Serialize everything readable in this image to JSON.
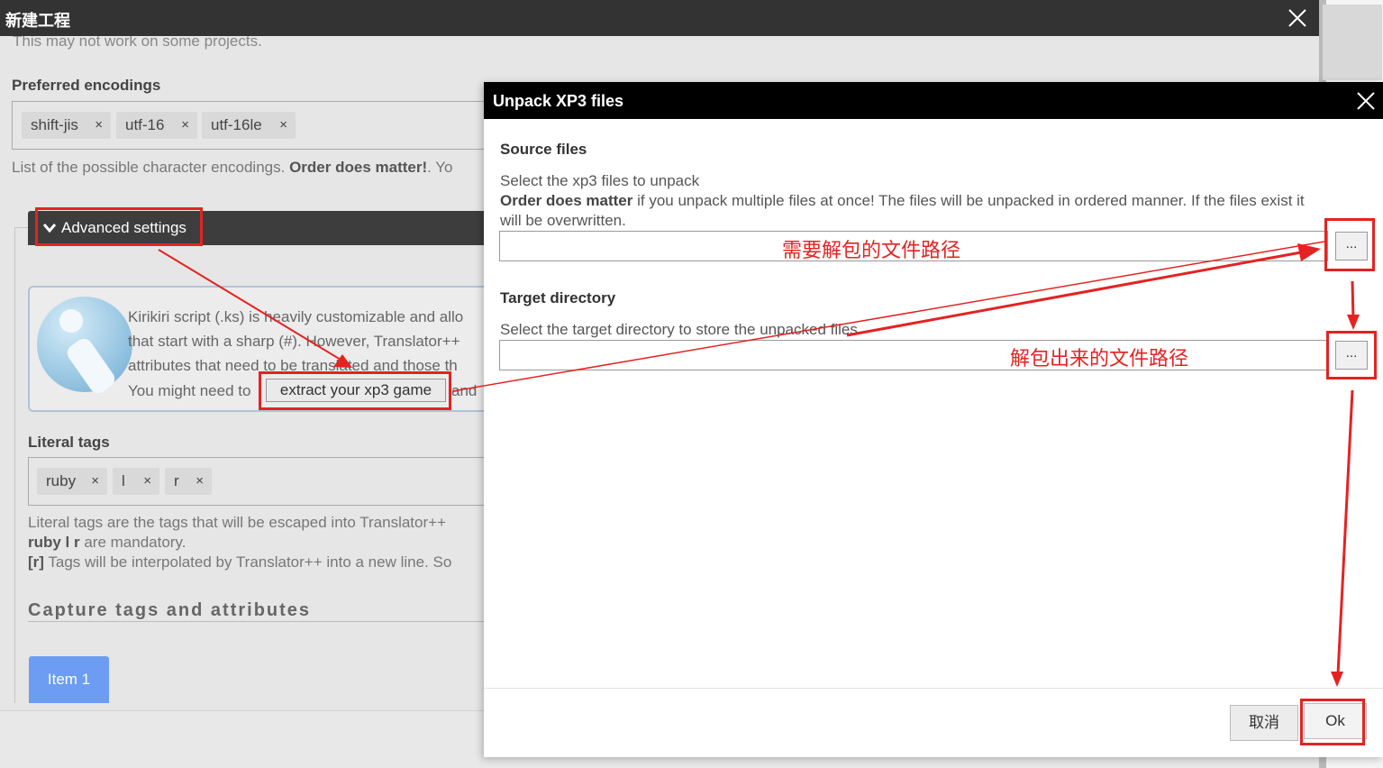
{
  "background_dialog": {
    "title": "新建工程",
    "faded_text": "This may not work on some projects.",
    "preferred_encodings_label": "Preferred encodings",
    "encodings": [
      "shift-jis",
      "utf-16",
      "utf-16le"
    ],
    "chip_remove_glyph": "×",
    "encodings_help_prefix": "List of the possible character encodings. ",
    "encodings_help_bold": "Order does matter!",
    "encodings_help_suffix": ". Yo",
    "advanced_settings_label": "Advanced settings",
    "info_lines": [
      "Kirikiri script (.ks) is heavily customizable and allo",
      "that start with a sharp (#). However, Translator++",
      "attributes that need to be translated and those th",
      "You might need to"
    ],
    "extract_button_label": "extract your xp3 game",
    "info_after_button": "and",
    "literal_tags_label": "Literal tags",
    "literal_tags": [
      "ruby",
      "l",
      "r"
    ],
    "literal_help_line1": "Literal tags are the tags that will be escaped into Translator++",
    "literal_help_line2_bold": "ruby l r",
    "literal_help_line2": " are mandatory.",
    "literal_help_line3_bold": "[r]",
    "literal_help_line3": " Tags will be interpolated by Translator++ into a new line. So",
    "capture_heading": "Capture tags and attributes",
    "item_tab_label": "Item 1"
  },
  "unpack_dialog": {
    "title": "Unpack XP3 files",
    "source_label": "Source files",
    "source_desc": "Select the xp3 files to unpack",
    "source_note_bold": "Order does matter",
    "source_note": " if you unpack multiple files at once! The files will be unpacked in ordered manner. If the files exist it",
    "source_note_line2": "will be overwritten.",
    "source_value": "",
    "browse_label": "...",
    "target_label": "Target directory",
    "target_desc": "Select the target directory to store the unpacked files",
    "target_value": "",
    "cancel_label": "取消",
    "ok_label": "Ok"
  },
  "annotations": {
    "source_note_cn": "需要解包的文件路径",
    "target_note_cn": "解包出来的文件路径",
    "color": "#e52222"
  }
}
